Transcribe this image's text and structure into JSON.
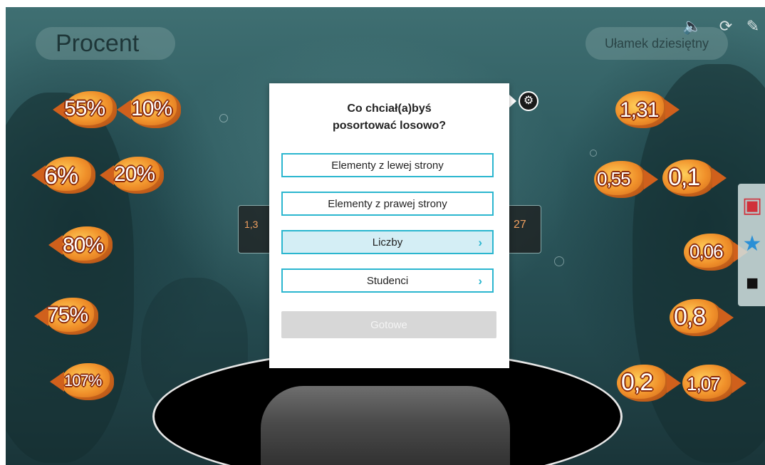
{
  "headers": {
    "left": "Procent",
    "right": "Ułamek dziesiętny"
  },
  "top_icons": [
    "speaker-icon",
    "refresh-icon",
    "pencil-icon"
  ],
  "left_fish": [
    "55%",
    "10%",
    "6%",
    "20%",
    "80%",
    "75%",
    "107%"
  ],
  "right_fish": [
    "1,31",
    "0,55",
    "0,1",
    "0,06",
    "0,8",
    "0,2",
    "1,07"
  ],
  "behind_panels": {
    "left": "1,3",
    "right": "27"
  },
  "modal": {
    "question_line1": "Co chciał(a)byś",
    "question_line2": "posortować losowo?",
    "options": [
      {
        "label": "Elementy z lewej strony",
        "selected": false,
        "has_submenu": false
      },
      {
        "label": "Elementy z prawej strony",
        "selected": false,
        "has_submenu": false
      },
      {
        "label": "Liczby",
        "selected": true,
        "has_submenu": true
      },
      {
        "label": "Studenci",
        "selected": false,
        "has_submenu": true
      }
    ],
    "done_label": "Gotowe",
    "gear_icon": "gear-icon"
  },
  "colors": {
    "accent": "#2bb6cf",
    "selected_bg": "#d4eef5",
    "done_bg": "#d7d7d7"
  }
}
